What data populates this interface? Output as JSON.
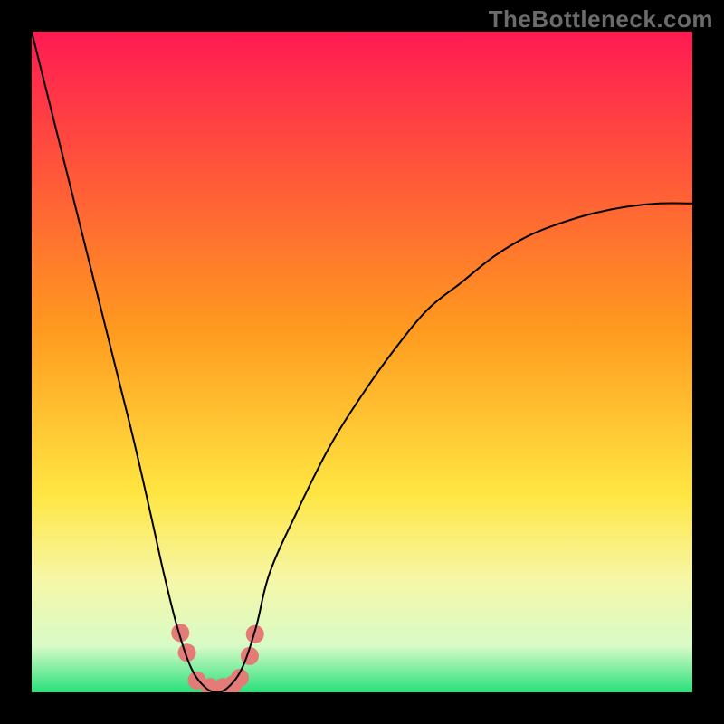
{
  "watermark": "TheBottleneck.com",
  "chart_data": {
    "type": "line",
    "title": "",
    "xlabel": "",
    "ylabel": "",
    "xlim": [
      0,
      100
    ],
    "ylim": [
      0,
      100
    ],
    "grid": false,
    "legend": false,
    "gradient_stops": [
      {
        "offset": 0,
        "color": "#ff1a52"
      },
      {
        "offset": 0.45,
        "color": "#ff9a1f"
      },
      {
        "offset": 0.7,
        "color": "#ffe642"
      },
      {
        "offset": 0.83,
        "color": "#f6f7a8"
      },
      {
        "offset": 0.93,
        "color": "#d8fbc6"
      },
      {
        "offset": 1.0,
        "color": "#28e07c"
      }
    ],
    "series": [
      {
        "name": "bottleneck-curve",
        "x": [
          0,
          5,
          10,
          15,
          18,
          20,
          22,
          24,
          26,
          28,
          30,
          32,
          34,
          36,
          40,
          45,
          50,
          55,
          60,
          65,
          70,
          75,
          80,
          85,
          90,
          95,
          100
        ],
        "values": [
          100,
          80,
          60,
          40,
          27,
          18,
          10,
          4,
          1,
          0,
          1,
          4,
          10,
          18,
          27,
          37,
          45,
          52,
          58,
          62,
          66,
          69,
          71,
          72.5,
          73.5,
          74,
          74
        ]
      }
    ],
    "markers": {
      "name": "highlight-points",
      "color": "#e37b77",
      "radius": 10,
      "points": [
        {
          "x": 22.5,
          "y": 9
        },
        {
          "x": 23.5,
          "y": 6
        },
        {
          "x": 25.0,
          "y": 1.8
        },
        {
          "x": 27.0,
          "y": 0.8
        },
        {
          "x": 29.0,
          "y": 0.8
        },
        {
          "x": 30.5,
          "y": 1.2
        },
        {
          "x": 31.5,
          "y": 2.2
        },
        {
          "x": 33.0,
          "y": 5.5
        },
        {
          "x": 33.8,
          "y": 8.8
        }
      ]
    }
  }
}
